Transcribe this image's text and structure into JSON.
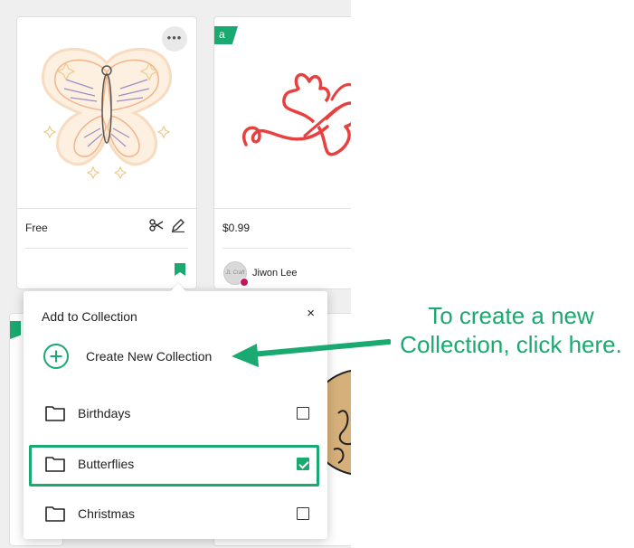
{
  "cards": [
    {
      "price": "Free",
      "more_label": "•••"
    },
    {
      "price": "$0.99",
      "access_tag": "a",
      "designer": {
        "name": "Jiwon Lee",
        "avatar_text": "JL Craft"
      }
    }
  ],
  "popup": {
    "title": "Add to Collection",
    "close": "×",
    "create_label": "Create New Collection",
    "collections": [
      {
        "label": "Birthdays",
        "checked": false
      },
      {
        "label": "Butterflies",
        "checked": true
      },
      {
        "label": "Christmas",
        "checked": false
      }
    ]
  },
  "annotation": {
    "line1": "To create a new",
    "line2": "Collection, click here."
  },
  "colors": {
    "accent": "#19a971",
    "butterfly_red": "#e8403f",
    "butterfly_peach": "#f6c9a4",
    "sticker_bg": "#fdf0e1"
  }
}
